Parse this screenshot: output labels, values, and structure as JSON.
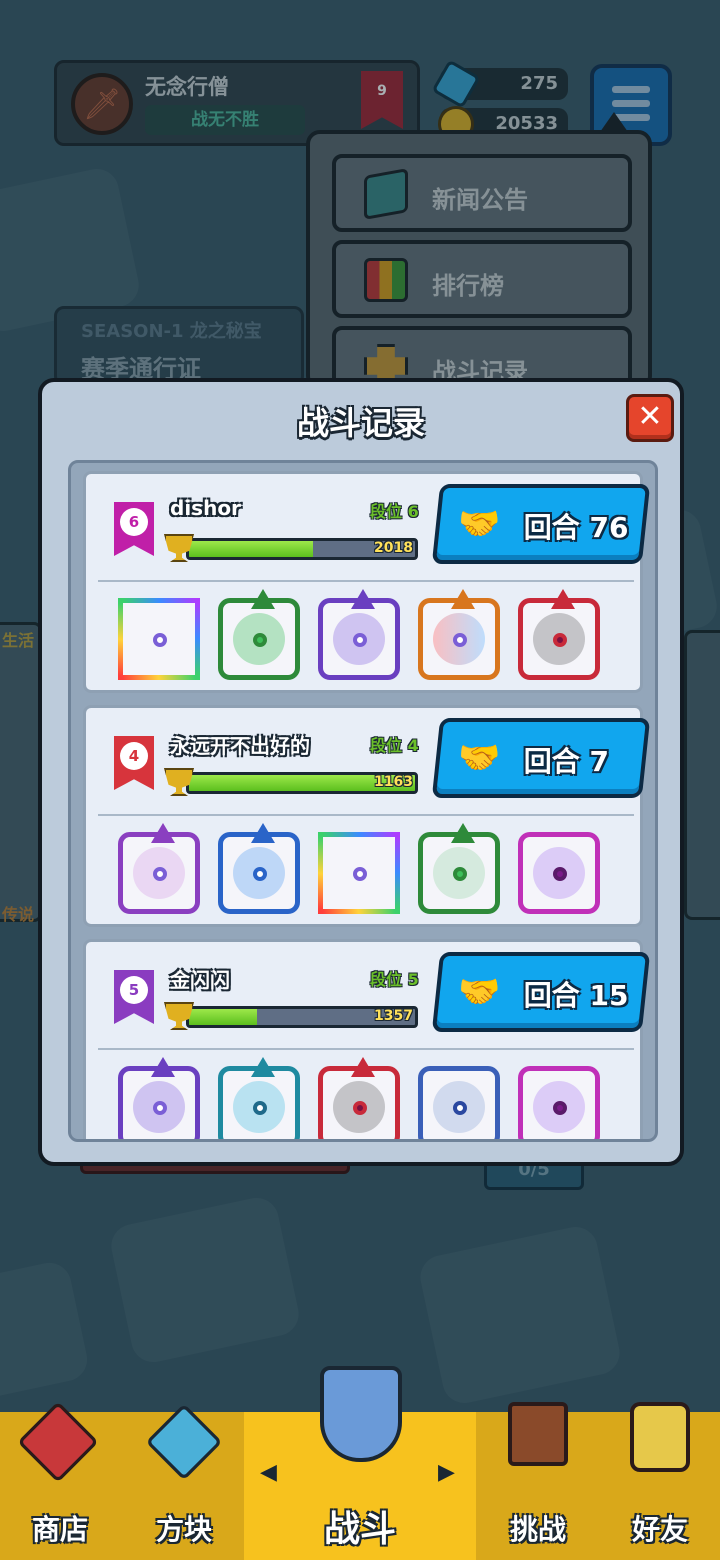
{
  "player": {
    "name": "无念行僧",
    "title": "战无不胜",
    "rank_level": "9"
  },
  "currency": {
    "gems": "275",
    "gold": "20533"
  },
  "menu": {
    "items": [
      {
        "label": "新闻公告",
        "icon": "news-monitor-icon"
      },
      {
        "label": "排行榜",
        "icon": "leaderboard-bars-icon"
      },
      {
        "label": "战斗记录",
        "icon": "battle-record-icon"
      }
    ]
  },
  "season": {
    "tag": "SEASON-1 龙之秘宝",
    "pass": "赛季通行证"
  },
  "side": {
    "left_top": "生活",
    "left_bottom": "传说"
  },
  "under_tag": "0/5",
  "modal": {
    "title": "战斗记录",
    "close_label": "✕",
    "records": [
      {
        "name": "dishor",
        "rank": "6",
        "tier": "段位 6",
        "trophies": "2018",
        "progress": 0.55,
        "round_label": "回合 76",
        "badge_color": "#c01fa8",
        "dice": [
          "rainbow-mirror-die",
          "green-dragon-wind-die",
          "purple-dragon-arrow-die",
          "orange-dragon-infinity-die",
          "red-dragon-vortex-die"
        ]
      },
      {
        "name": "永远开不出好的",
        "rank": "4",
        "tier": "段位 4",
        "trophies": "1163",
        "progress": 1.0,
        "round_label": "回合 7",
        "badge_color": "#d7343c",
        "dice": [
          "purple-dragon-combo-die",
          "blue-dragon-moon-die",
          "rainbow-mirror-die",
          "green-dragon-pentagram-die",
          "magenta-arrow-die"
        ]
      },
      {
        "name": "金闪闪",
        "rank": "5",
        "tier": "段位 5",
        "trophies": "1357",
        "progress": 0.3,
        "round_label": "回合 15",
        "badge_color": "#8a3cc0",
        "dice": [
          "purple-dragon-arrow-die",
          "teal-dragon-swirl-die",
          "red-dragon-vortex-die",
          "blue-gear-die",
          "magenta-arrow-die"
        ]
      }
    ]
  },
  "bottom_nav": [
    {
      "label": "商店",
      "icon": "shop-icon"
    },
    {
      "label": "方块",
      "icon": "dice-box-icon"
    },
    {
      "label": "战斗",
      "icon": "battle-shield-icon",
      "active": true
    },
    {
      "label": "挑战",
      "icon": "challenge-sign-icon"
    },
    {
      "label": "好友",
      "icon": "friends-icon"
    }
  ],
  "colors": {
    "accent": "#11a6ee",
    "close": "#e5452c",
    "progress": "#6ecf2a",
    "nav_bg": "#f7c21e"
  }
}
